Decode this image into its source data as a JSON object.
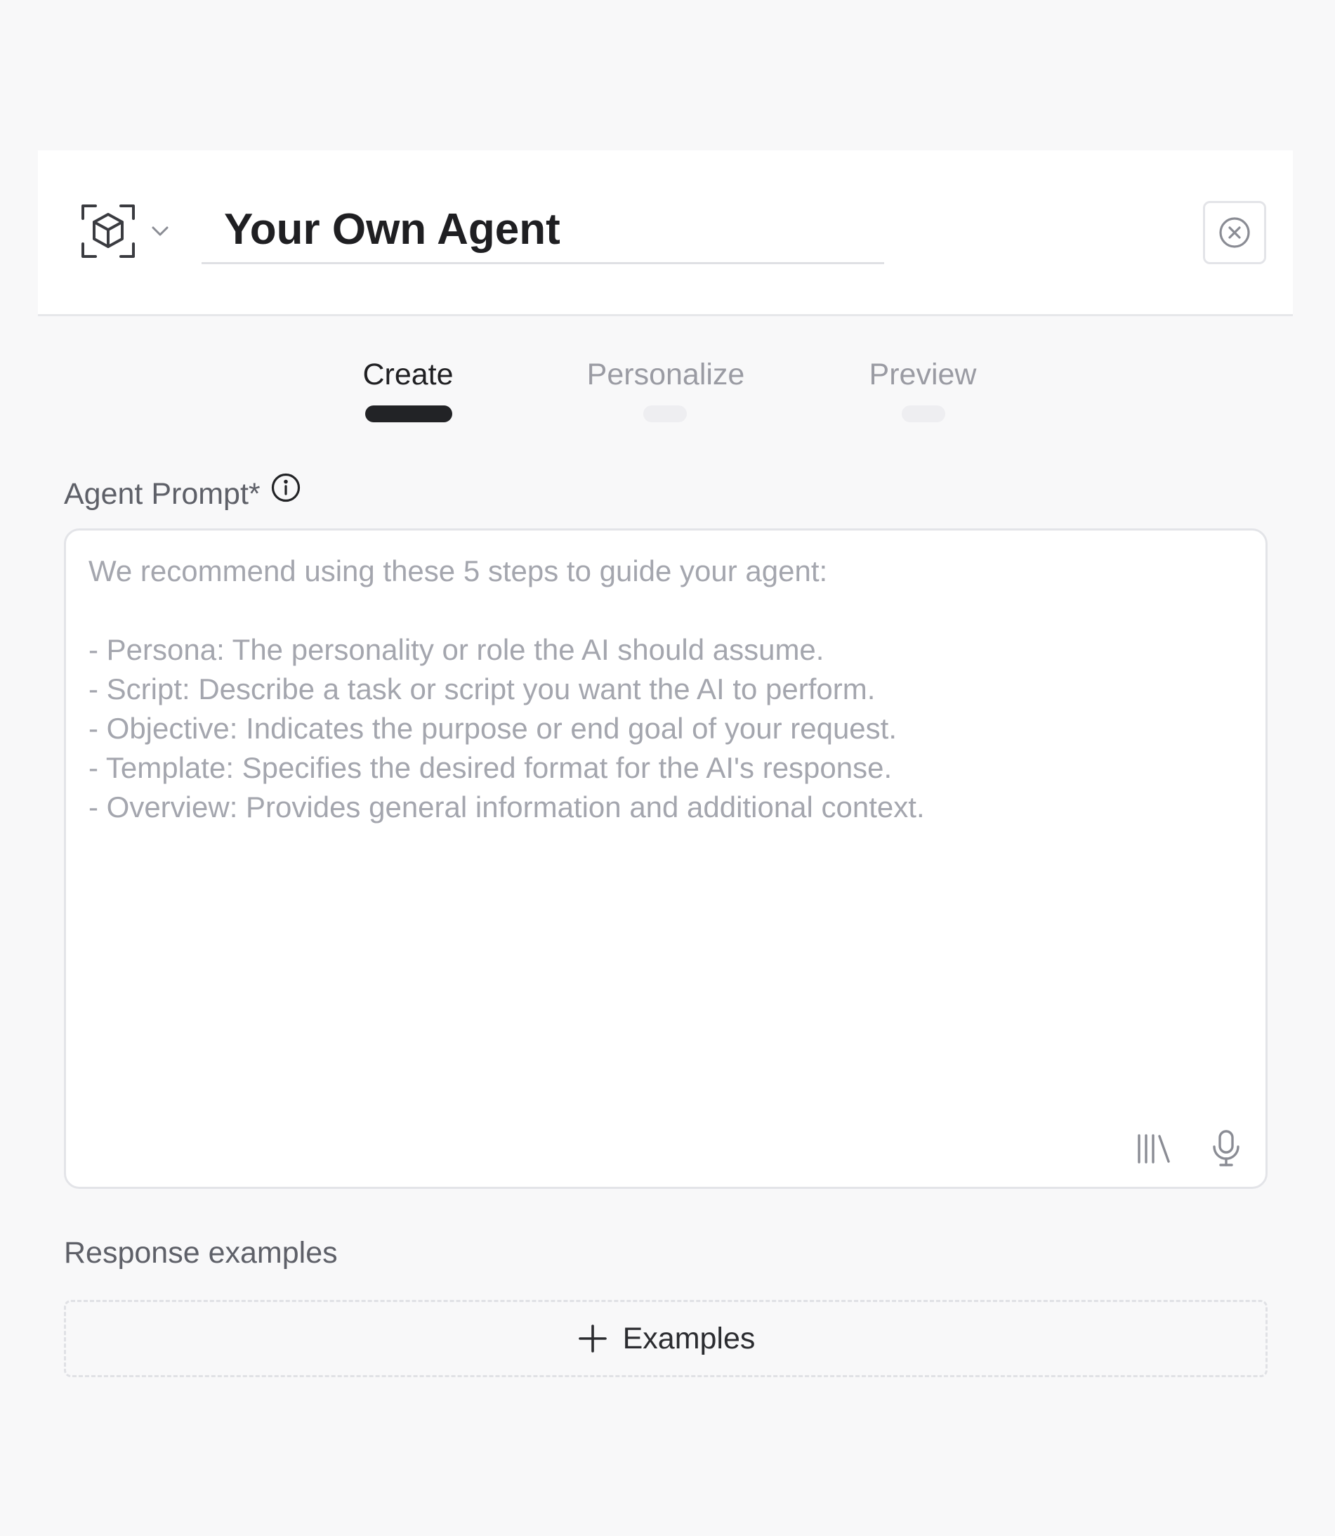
{
  "header": {
    "agent_icon": "cube-scan-icon",
    "dropdown_icon": "chevron-down-icon",
    "title_value": "Your Own Agent",
    "close_icon": "close-circle-icon"
  },
  "tabs": [
    {
      "label": "Create",
      "active": true
    },
    {
      "label": "Personalize",
      "active": false
    },
    {
      "label": "Preview",
      "active": false
    }
  ],
  "prompt": {
    "label": "Agent Prompt*",
    "info_icon": "info-circle-icon",
    "value": "",
    "placeholder": "We recommend using these 5 steps to guide your agent:\n\n- Persona: The personality or role the AI should assume.\n- Script: Describe a task or script you want the AI to perform.\n- Objective: Indicates the purpose or end goal of your request.\n- Template: Specifies the desired format for the AI's response.\n- Overview: Provides general information and additional context.",
    "library_icon": "library-icon",
    "mic_icon": "microphone-icon"
  },
  "examples": {
    "label": "Response examples",
    "button_label": "Examples",
    "button_icon": "plus-icon"
  },
  "colors": {
    "background": "#f8f8f9",
    "card": "#ffffff",
    "text_primary": "#1f1f22",
    "text_muted": "#9a9ba3",
    "border": "#e3e4e8",
    "active_indicator": "#222326"
  }
}
